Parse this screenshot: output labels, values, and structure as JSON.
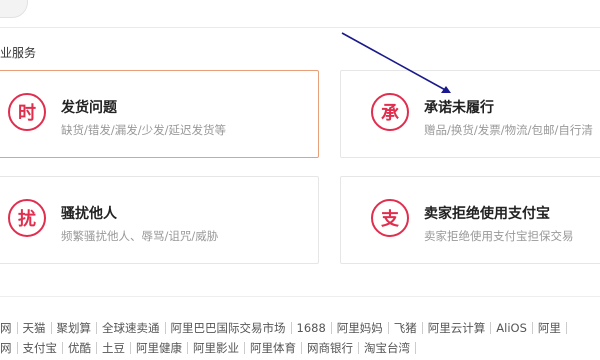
{
  "section": {
    "title": "业服务"
  },
  "cards": [
    {
      "icon_char": "时",
      "title": "发货问题",
      "desc": "缺货/错发/漏发/少发/延迟发货等"
    },
    {
      "icon_char": "承",
      "title": "承诺未履行",
      "desc": "赠品/换货/发票/物流/包邮/自行清"
    },
    {
      "icon_char": "扰",
      "title": "骚扰他人",
      "desc": "频繁骚扰他人、辱骂/诅咒/威胁"
    },
    {
      "icon_char": "支",
      "title": "卖家拒绝使用支付宝",
      "desc": "卖家拒绝使用支付宝担保交易"
    }
  ],
  "footer": {
    "row1": [
      "网",
      "天猫",
      "聚划算",
      "全球速卖通",
      "阿里巴巴国际交易市场",
      "1688",
      "阿里妈妈",
      "飞猪",
      "阿里云计算",
      "AliOS",
      "阿里"
    ],
    "row2": [
      "网",
      "支付宝",
      "优酷",
      "土豆",
      "阿里健康",
      "阿里影业",
      "阿里体育",
      "网商银行",
      "淘宝台湾"
    ]
  },
  "colors": {
    "accent_red": "#e02e4f",
    "active_border": "#e8a07a",
    "arrow": "#1a1a8c"
  }
}
